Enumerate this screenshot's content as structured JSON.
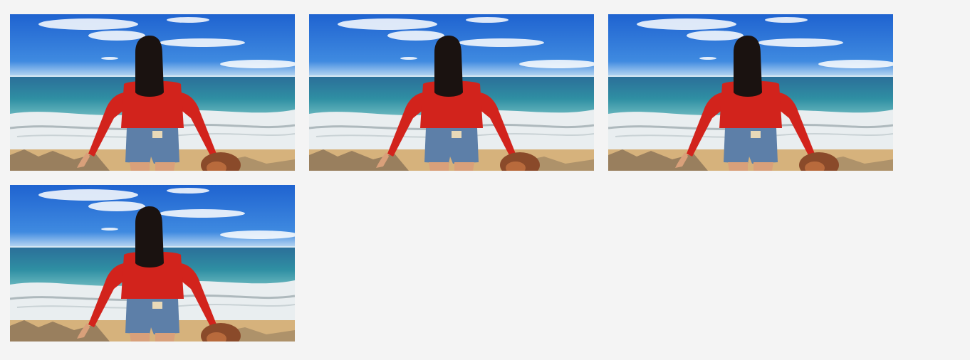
{
  "gallery": {
    "photos": [
      {
        "subject": "beach-woman-red-top-photo"
      },
      {
        "subject": "beach-woman-red-top-photo"
      },
      {
        "subject": "beach-woman-red-top-photo"
      },
      {
        "subject": "beach-woman-red-top-photo"
      }
    ]
  },
  "colors": {
    "page_background": "#f4f4f4",
    "sky_top": "#1f63d0",
    "sky_horizon": "#bcd9f2",
    "sea": "#2f8fa3",
    "surf": "#e9eef0",
    "sand": "#d6b27c",
    "top_red": "#d2231c",
    "denim": "#5d7fa8",
    "hair": "#1a1210",
    "skin": "#d9a07a"
  }
}
